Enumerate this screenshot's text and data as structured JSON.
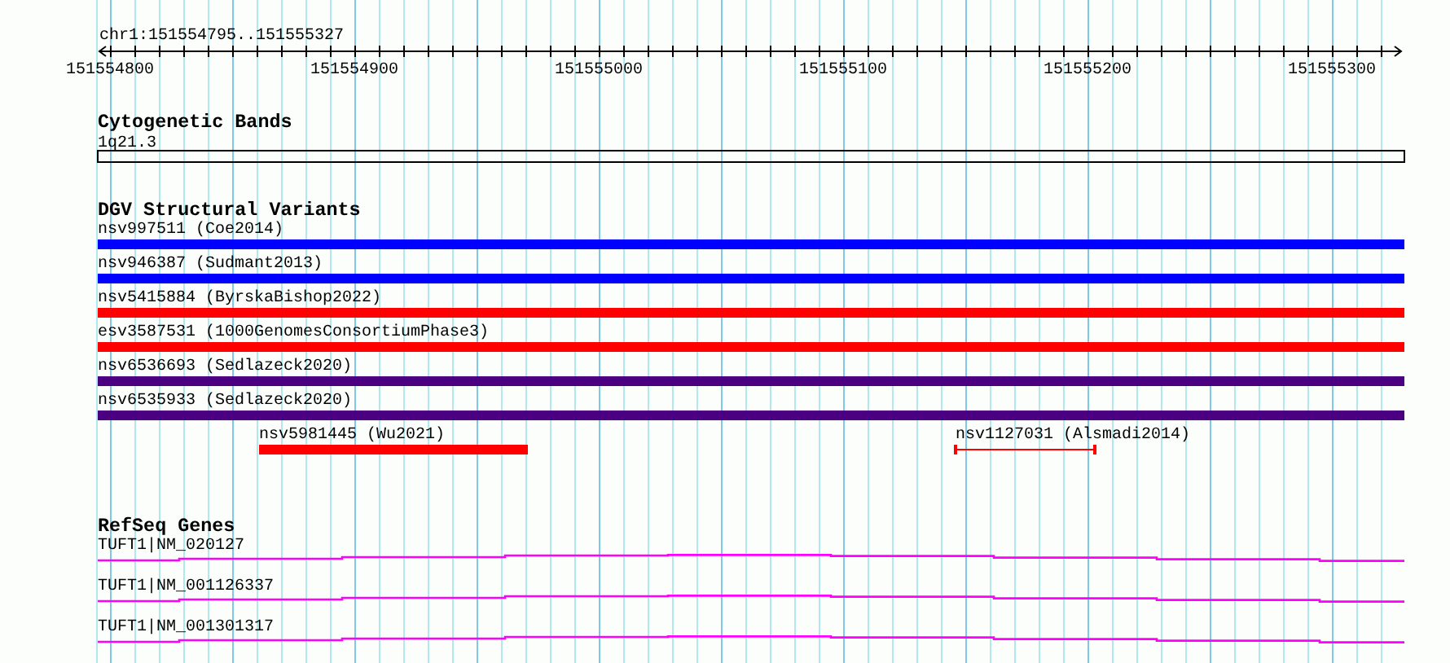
{
  "location": "chr1:151554795..151555327",
  "ruler": {
    "ticks": [
      {
        "label": "151554800"
      },
      {
        "label": "151554900"
      },
      {
        "label": "151555000"
      },
      {
        "label": "151555100"
      },
      {
        "label": "151555200"
      },
      {
        "label": "151555300"
      }
    ]
  },
  "tracks": [
    {
      "kind": "cytoband",
      "title": "Cytogenetic Bands",
      "features": [
        {
          "label": "1q21.3"
        }
      ]
    },
    {
      "kind": "variants",
      "title": "DGV Structural Variants",
      "rows": [
        [
          {
            "label": "nsv997511 (Coe2014)",
            "color": "#0000ff",
            "kind": "bar"
          }
        ],
        [
          {
            "label": "nsv946387 (Sudmant2013)",
            "color": "#0000ff",
            "kind": "bar"
          }
        ],
        [
          {
            "label": "nsv5415884 (ByrskaBishop2022)",
            "color": "#ff0000",
            "kind": "bar"
          }
        ],
        [
          {
            "label": "esv3587531 (1000GenomesConsortiumPhase3)",
            "color": "#ff0000",
            "kind": "bar"
          }
        ],
        [
          {
            "label": "nsv6536693 (Sedlazeck2020)",
            "color": "#4b0082",
            "kind": "bar"
          }
        ],
        [
          {
            "label": "nsv6535933 (Sedlazeck2020)",
            "color": "#4b0082",
            "kind": "bar"
          }
        ],
        [
          {
            "label": "nsv5981445 (Wu2021)",
            "color": "#ff0000",
            "kind": "bar"
          },
          {
            "label": "nsv1127031 (Alsmadi2014)",
            "color": "#ff0000",
            "kind": "span"
          }
        ]
      ]
    },
    {
      "kind": "genes",
      "title": "RefSeq Genes",
      "features": [
        {
          "label": "TUFT1|NM_020127"
        },
        {
          "label": "TUFT1|NM_001126337"
        },
        {
          "label": "TUFT1|NM_001301317"
        }
      ]
    }
  ]
}
